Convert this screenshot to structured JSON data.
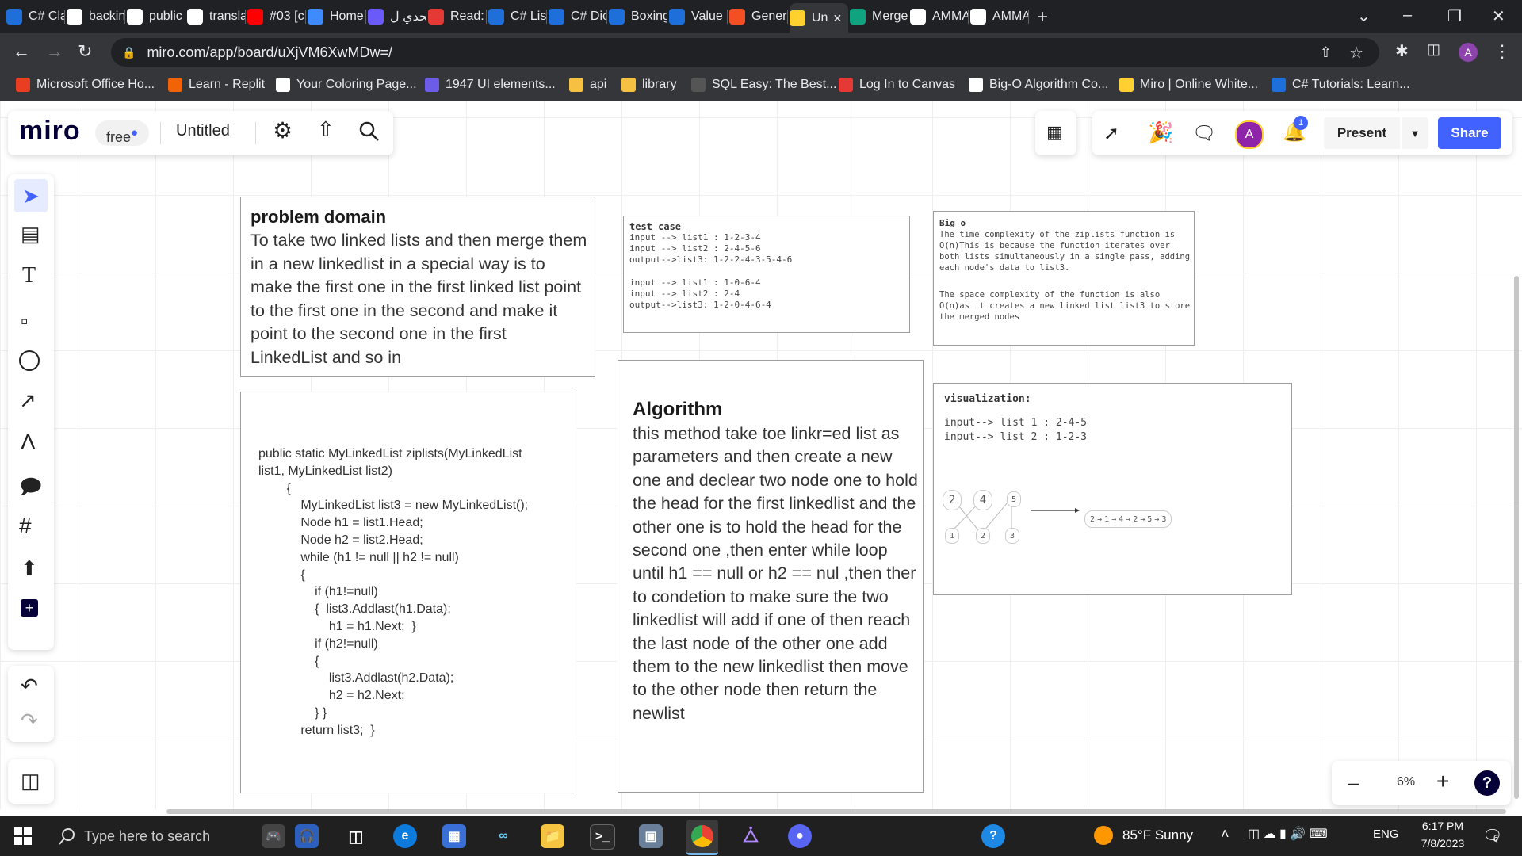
{
  "browser": {
    "tabs": [
      {
        "label": "C# Cla",
        "icon": "tt-icon",
        "color": "#1e6fd9"
      },
      {
        "label": "backin",
        "icon": "google-icon",
        "color": "#ffffff"
      },
      {
        "label": "public",
        "icon": "google-icon",
        "color": "#ffffff"
      },
      {
        "label": "transla",
        "icon": "google-icon",
        "color": "#ffffff"
      },
      {
        "label": "#03 [c",
        "icon": "youtube-icon",
        "color": "#ff0000"
      },
      {
        "label": "Home",
        "icon": "circle-c-icon",
        "color": "#3d8bfd"
      },
      {
        "label": "تحدي ل",
        "icon": "video-icon",
        "color": "#6a5af9"
      },
      {
        "label": "Read:",
        "icon": "gear-red-icon",
        "color": "#e53935"
      },
      {
        "label": "C# List",
        "icon": "tt-icon",
        "color": "#1e6fd9"
      },
      {
        "label": "C# Dic",
        "icon": "tt-icon",
        "color": "#1e6fd9"
      },
      {
        "label": "Boxing",
        "icon": "tt-icon",
        "color": "#1e6fd9"
      },
      {
        "label": "Value",
        "icon": "tt-icon",
        "color": "#1e6fd9"
      },
      {
        "label": "Generi",
        "icon": "windows-icon",
        "color": "#f25022"
      },
      {
        "label": "Un",
        "icon": "miro-icon",
        "color": "#ffd02f"
      },
      {
        "label": "Merge",
        "icon": "chatgpt-icon",
        "color": "#10a37f"
      },
      {
        "label": "AMMA",
        "icon": "github-icon",
        "color": "#ffffff"
      },
      {
        "label": "AMMA",
        "icon": "github-icon",
        "color": "#ffffff"
      }
    ],
    "new_tab": "+",
    "url": "miro.com/app/board/uXjVM6XwMDw=/",
    "profile_initial": "A",
    "bookmarks": [
      {
        "label": "Microsoft Office Ho...",
        "color": "#ea3e23"
      },
      {
        "label": "Learn - Replit",
        "color": "#f26207"
      },
      {
        "label": "Your Coloring Page...",
        "color": "#ffffff"
      },
      {
        "label": "1947 UI elements...",
        "color": "#6c5ce7"
      },
      {
        "label": "api",
        "color": "#f6c142"
      },
      {
        "label": "library",
        "color": "#f6c142"
      },
      {
        "label": "SQL Easy: The Best...",
        "color": "#555555"
      },
      {
        "label": "Log In to Canvas",
        "color": "#e53935"
      },
      {
        "label": "Big-O Algorithm Co...",
        "color": "#ffffff"
      },
      {
        "label": "Miro | Online White...",
        "color": "#ffd02f"
      },
      {
        "label": "C# Tutorials: Learn...",
        "color": "#1e6fd9"
      }
    ]
  },
  "miro": {
    "logo": "miro",
    "plan": "free",
    "board_title": "Untitled",
    "present_label": "Present",
    "share_label": "Share",
    "avatar_initial": "A",
    "notification_count": "1",
    "zoom": "6%",
    "help": "?"
  },
  "board": {
    "problem": {
      "title": "problem domain",
      "body": "To take two linked lists and then merge them in a new linkedlist in a special way is to make the first one in the first linked list point to the first one in the second and make it point to the second one in the first LinkedList and so in"
    },
    "code": {
      "lines": [
        "public static MyLinkedList ziplists(MyLinkedList",
        "list1, MyLinkedList list2)",
        "        {",
        "            MyLinkedList list3 = new MyLinkedList();",
        "            Node h1 = list1.Head;",
        "            Node h2 = list2.Head;",
        "            while (h1 != null || h2 != null)",
        "            {",
        "                if (h1!=null)",
        "                {  list3.Addlast(h1.Data);",
        "                    h1 = h1.Next;  }",
        "                if (h2!=null)",
        "                {",
        "                    list3.Addlast(h2.Data);",
        "                    h2 = h2.Next;",
        "                } }",
        "            return list3;  }"
      ]
    },
    "testcase": {
      "title": "test case",
      "lines": [
        "input --> list1 : 1-2-3-4",
        "input --> list2 : 2-4-5-6",
        "output-->list3: 1-2-2-4-3-5-4-6",
        "",
        "input --> list1 : 1-0-6-4",
        "input --> list2 : 2-4",
        "output-->list3: 1-2-0-4-6-4"
      ]
    },
    "algorithm": {
      "title": "Algorithm",
      "body": "this method take toe linkr=ed list as parameters and then create a new one  and declear two node one to hold the head for the first linkedlist and the other one is to hold the head for the second one ,then enter  while loop until  h1 == null or h2 == nul ,then ther to condetion to make sure the two linkedlist will add if one of then reach the last node of the other one  add them to the new linkedlist then move to the other node then return the newlist"
    },
    "bigo": {
      "title": "Big o",
      "p1": "The time complexity of the ziplists function is O(n)This is because the function iterates over both lists simultaneously in a single pass, adding each node's data to list3.",
      "p2": "The space complexity of the function is also O(n)as it creates a new linked list list3 to store the merged nodes"
    },
    "visualization": {
      "title": "visualization:",
      "line1": "input--> list 1 : 2-4-5",
      "line2": "input--> list 2 : 1-2-3",
      "top_nodes": [
        "2",
        "4",
        "5"
      ],
      "bottom_nodes": [
        "1",
        "2",
        "3"
      ],
      "result": [
        "2",
        "1",
        "4",
        "2",
        "5",
        "3"
      ]
    }
  },
  "taskbar": {
    "search_placeholder": "Type here to search",
    "weather": "85°F  Sunny",
    "lang": "ENG",
    "time": "6:17 PM",
    "date": "7/8/2023",
    "notif_count": "6"
  }
}
